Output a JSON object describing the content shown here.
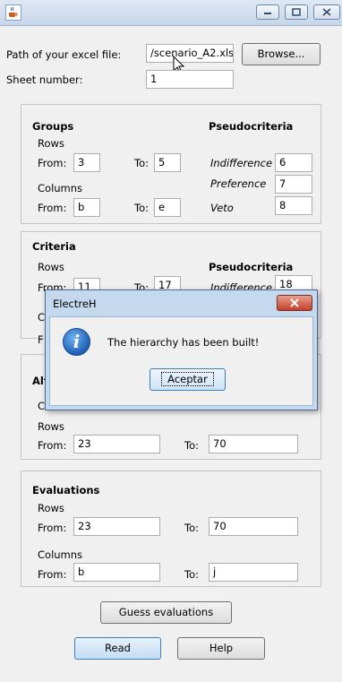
{
  "form": {
    "path_label": "Path of your excel file:",
    "path_value": "/scenario_A2.xls",
    "browse_label": "Browse...",
    "sheet_label": "Sheet number:",
    "sheet_value": "1"
  },
  "groups": {
    "title": "Groups",
    "rows_label": "Rows",
    "from_label": "From:",
    "to_label": "To:",
    "rows_from": "3",
    "rows_to": "5",
    "columns_label": "Columns",
    "cols_from": "b",
    "cols_to": "e"
  },
  "pseudocriteria_1": {
    "title": "Pseudocriteria",
    "indifference_label": "Indifference",
    "indifference_value": "6",
    "preference_label": "Preference",
    "preference_value": "7",
    "veto_label": "Veto",
    "veto_value": "8"
  },
  "criteria": {
    "title": "Criteria",
    "rows_label": "Rows",
    "from_label": "From:",
    "rows_from": "11",
    "to_label": "To:",
    "rows_to": "17",
    "partial_c": "C",
    "partial_f": "F"
  },
  "pseudocriteria_2": {
    "title": "Pseudocriteria",
    "indifference_label": "Indifference",
    "indifference_value": "18"
  },
  "alternatives": {
    "title_partial": "Alt",
    "partial_c": "C",
    "rows_label": "Rows",
    "from_label": "From:",
    "rows_from": "23",
    "to_label": "To:",
    "rows_to": "70"
  },
  "evaluations": {
    "title": "Evaluations",
    "rows_label": "Rows",
    "from_label": "From:",
    "rows_from": "23",
    "to_label": "To:",
    "rows_to": "70",
    "columns_label": "Columns",
    "cols_from": "b",
    "cols_to": "j"
  },
  "buttons": {
    "guess_label": "Guess evaluations",
    "read_label": "Read",
    "help_label": "Help"
  },
  "dialog": {
    "title": "ElectreH",
    "message": "The hierarchy has been built!",
    "ok_label": "Aceptar"
  },
  "icons": {
    "app": "java-cup-icon",
    "info": "information-icon",
    "cursor": "mouse-pointer-icon"
  },
  "colors": {
    "dialog_frame": "#c4d8ee",
    "close_button": "#c4402b",
    "info_icon": "#1f5fb5",
    "read_button": "#c4dcf3"
  }
}
